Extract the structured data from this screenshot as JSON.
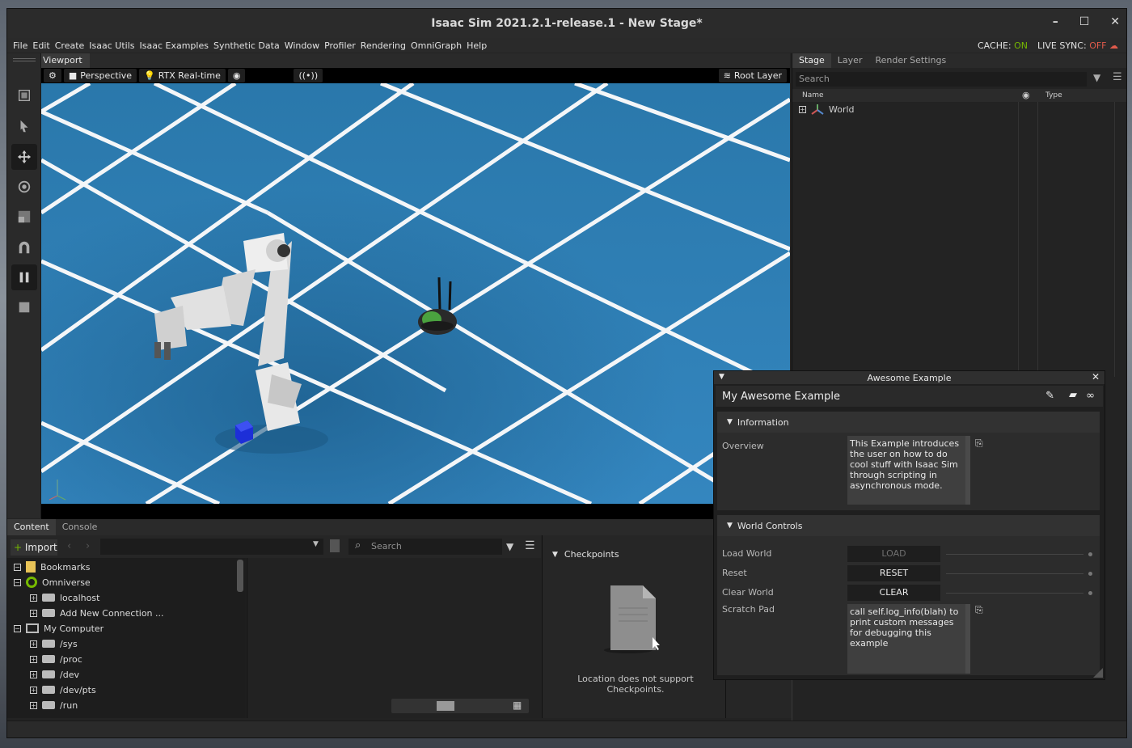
{
  "window": {
    "title": "Isaac Sim 2021.2.1-release.1 - New Stage*",
    "controls": [
      "–",
      "☐",
      "✕"
    ]
  },
  "menu": {
    "items": [
      "File",
      "Edit",
      "Create",
      "Isaac Utils",
      "Isaac Examples",
      "Synthetic Data",
      "Window",
      "Profiler",
      "Rendering",
      "OmniGraph",
      "Help"
    ],
    "cache_label": "CACHE:",
    "cache_value": "ON",
    "live_sync_label": "LIVE SYNC:",
    "live_sync_value": "OFF"
  },
  "viewport": {
    "tab": "Viewport",
    "camera": "Perspective",
    "renderer": "RTX Real-time",
    "layer": "Root Layer"
  },
  "stage": {
    "tabs": [
      "Stage",
      "Layer",
      "Render Settings"
    ],
    "search_placeholder": "Search",
    "col_name": "Name",
    "col_type": "Type",
    "tree": [
      "World"
    ]
  },
  "bottom": {
    "tabs": [
      "Content",
      "Console"
    ],
    "import_label": "Import",
    "search_placeholder": "Search",
    "tree": [
      {
        "label": "Bookmarks",
        "level": 0
      },
      {
        "label": "Omniverse",
        "level": 0
      },
      {
        "label": "localhost",
        "level": 1
      },
      {
        "label": "Add New Connection ...",
        "level": 1
      },
      {
        "label": "My Computer",
        "level": 0
      },
      {
        "label": "/sys",
        "level": 1
      },
      {
        "label": "/proc",
        "level": 1
      },
      {
        "label": "/dev",
        "level": 1
      },
      {
        "label": "/dev/pts",
        "level": 1
      },
      {
        "label": "/run",
        "level": 1
      }
    ],
    "checkpoints_title": "Checkpoints",
    "checkpoints_message": "Location does not support Checkpoints."
  },
  "awesome": {
    "window_title": "Awesome Example",
    "header": "My Awesome Example",
    "information": {
      "title": "Information",
      "overview_label": "Overview",
      "overview_text": "This Example introduces the user on how to do cool stuff with Isaac Sim through scripting in asynchronous mode."
    },
    "world_controls": {
      "title": "World Controls",
      "load_label": "Load World",
      "load_btn": "LOAD",
      "reset_label": "Reset",
      "reset_btn": "RESET",
      "clear_label": "Clear World",
      "clear_btn": "CLEAR",
      "scratch_label": "Scratch Pad",
      "scratch_text": "call self.log_info(blah) to print custom messages for debugging this example"
    }
  },
  "colors": {
    "nvidia_green": "#76b900",
    "off_red": "#e05a4b",
    "floor_blue": "#2d7fb3"
  }
}
